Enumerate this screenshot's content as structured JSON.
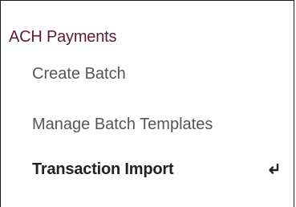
{
  "section": {
    "title": "ACH Payments"
  },
  "items": [
    {
      "label": "Create Batch"
    },
    {
      "label": "Manage Batch Templates"
    },
    {
      "label": "Transaction Import",
      "active": true,
      "icon": "enter-return-icon"
    }
  ],
  "colors": {
    "title": "#5c1a3b",
    "item": "#555555",
    "active_item": "#222222",
    "border": "#1a1a1a"
  }
}
